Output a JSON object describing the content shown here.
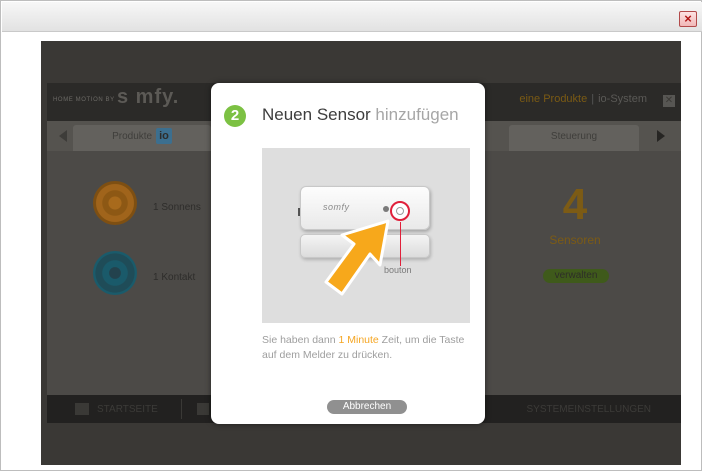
{
  "window": {
    "close_glyph": "×"
  },
  "app": {
    "brand_tag": "HOME MOTION BY",
    "brand": "s mfy.",
    "nav": {
      "products": "eine Produkte",
      "separator": "|",
      "system": "io-System"
    },
    "tabs": [
      {
        "label": "Produkte",
        "badge": "io"
      },
      {
        "label": "Steuerung"
      }
    ],
    "devices": [
      {
        "label": "1 Sonnens"
      },
      {
        "label": "1 Kontakt"
      }
    ],
    "sensors": {
      "count": "4",
      "label": "Sensoren",
      "manage": "verwalten"
    },
    "bottom": {
      "home": "STARTSEITE",
      "settings": "SYSTEMEINSTELLUNGEN"
    }
  },
  "modal": {
    "step": "2",
    "title_main": "Neuen Sensor",
    "title_accent": "hinzufügen",
    "illustration": {
      "device_logo": "somfy",
      "button_label": "bouton"
    },
    "text_before": "Sie haben dann ",
    "text_highlight": "1 Minute",
    "text_after": " Zeit, um die Taste auf dem Melder zu drücken.",
    "cancel": "Abbrechen"
  },
  "colors": {
    "accent_green": "#7cc143",
    "highlight_orange": "#f5a623",
    "pointer_orange": "#f7a81b",
    "ring_red": "#e0203a"
  },
  "icons": [
    "close-icon",
    "step-2-icon",
    "pointer-arrow-icon",
    "home-icon",
    "tab-prev-icon",
    "tab-next-icon"
  ]
}
